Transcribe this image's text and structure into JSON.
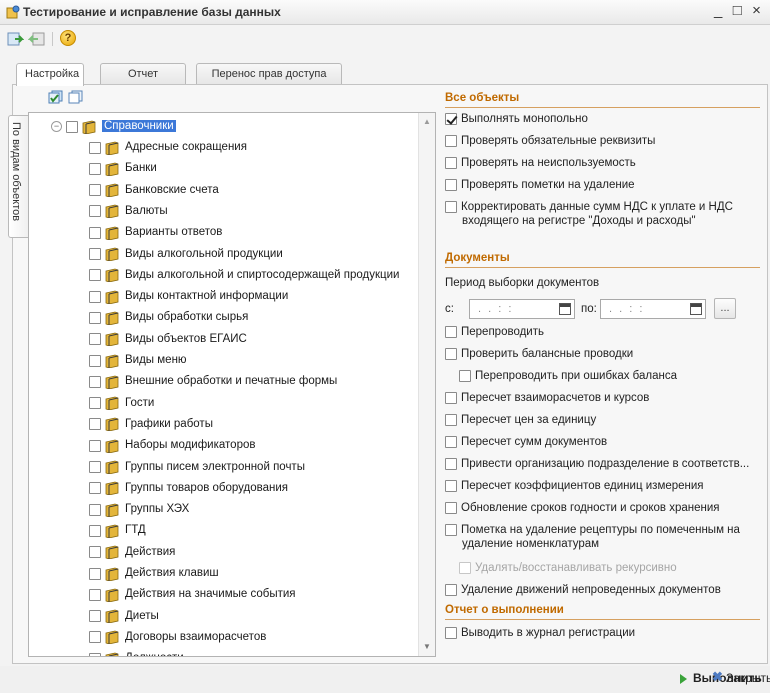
{
  "window": {
    "title": "Тестирование и исправление базы данных",
    "controls": [
      "_",
      "□",
      "×"
    ]
  },
  "toolbar": {
    "icons": [
      "save-settings-icon",
      "restore-settings-icon",
      "help-icon"
    ],
    "help_glyph": "?"
  },
  "tabs": [
    "Настройка",
    "Отчет",
    "Перенос прав доступа"
  ],
  "left": {
    "vertical_tab": "По видам объектов",
    "root": "Справочники",
    "items": [
      "Адресные сокращения",
      "Банки",
      "Банковские счета",
      "Валюты",
      "Варианты ответов",
      "Виды алкогольной продукции",
      "Виды алкогольной и спиртосодержащей продукции",
      "Виды контактной информации",
      "Виды обработки сырья",
      "Виды объектов ЕГАИС",
      "Виды меню",
      "Внешние обработки и печатные формы",
      "Гости",
      "Графики работы",
      "Наборы модификаторов",
      "Группы писем электронной почты",
      "Группы товаров оборудования",
      "Группы ХЭХ",
      "ГТД",
      "Действия",
      "Действия клавиш",
      "Действия на значимые события",
      "Диеты",
      "Договоры взаиморасчетов",
      "Должности"
    ]
  },
  "all_objects": {
    "header": "Все объекты",
    "options": [
      {
        "label": "Выполнять монопольно",
        "checked": true
      },
      {
        "label": "Проверять обязательные реквизиты",
        "checked": false
      },
      {
        "label": "Проверять на неиспользуемость",
        "checked": false
      },
      {
        "label": "Проверять пометки на удаление",
        "checked": false
      }
    ],
    "vat_line1": "Корректировать данные сумм НДС к уплате и НДС",
    "vat_line2": "входящего на регистре \"Доходы и расходы\""
  },
  "documents": {
    "header": "Документы",
    "period_label": "Период выборки документов",
    "from_label": "с:",
    "to_label": "по:",
    "date_placeholder": " .  .   : :",
    "dots_button": "...",
    "repost": "Перепроводить",
    "check_balance": "Проверить балансные проводки",
    "repost_on_errors": "Перепроводить при ошибках баланса",
    "options": [
      "Пересчет взаиморасчетов и курсов",
      "Пересчет цен за единицу",
      "Пересчет сумм документов",
      "Привести организацию подразделение в соответств...",
      "Пересчет коэффициентов единиц измерения",
      "Обновление сроков годности и сроков хранения"
    ],
    "mark_line1": "Пометка на удаление рецептуры по помеченным на",
    "mark_line2": "удаление номенклатурам",
    "recursive": "Удалять/восстанавливать рекурсивно",
    "delete_movements": "Удаление движений непроведенных документов"
  },
  "report": {
    "header": "Отчет о выполнении",
    "log": "Выводить в журнал регистрации"
  },
  "footer": {
    "run": "Выполнить",
    "close": "Закрыть"
  },
  "colors": {
    "section_header": "#c06a00",
    "selection": "#3c78d8",
    "book_icon": "#e3b53a"
  }
}
